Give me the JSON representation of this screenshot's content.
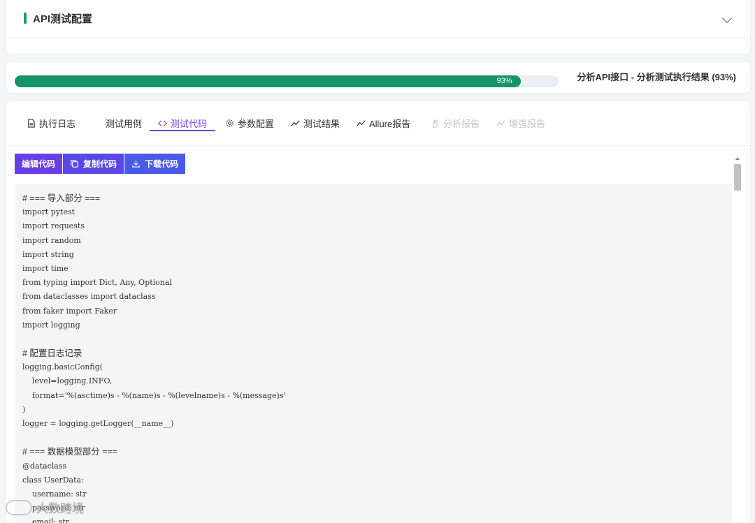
{
  "config": {
    "title": "API测试配置",
    "accent_color": "#1e9e6a",
    "collapse_icon": "chevron-down-icon"
  },
  "progress": {
    "percent_label": "93%",
    "value": 0.93,
    "status_text": "分析API接口 - 分析测试执行结果 (93%)",
    "bar_color": "#16936a"
  },
  "tabs": [
    {
      "label": "执行日志",
      "icon": "document-icon",
      "state": "normal"
    },
    {
      "label": "测试用例",
      "icon": "",
      "state": "normal"
    },
    {
      "label": "测试代码",
      "icon": "code-icon",
      "state": "active"
    },
    {
      "label": "参数配置",
      "icon": "gear-icon",
      "state": "normal"
    },
    {
      "label": "测试结果",
      "icon": "trend-icon",
      "state": "normal"
    },
    {
      "label": "Allure报告",
      "icon": "trend-icon",
      "state": "normal"
    },
    {
      "label": "分析报告",
      "icon": "hand-icon",
      "state": "disabled"
    },
    {
      "label": "增强报告",
      "icon": "trend-icon",
      "state": "disabled"
    }
  ],
  "active_color": "#7b3fe4",
  "toolbar": {
    "edit_label": "编辑代码",
    "copy_label": "复制代码",
    "download_label": "下载代码"
  },
  "code_lines": [
    "# === 导入部分 ===",
    "import pytest",
    "import requests",
    "import random",
    "import string",
    "import time",
    "from typing import Dict, Any, Optional",
    "from dataclasses import dataclass",
    "from faker import Faker",
    "import logging",
    "",
    "# 配置日志记录",
    "logging.basicConfig(",
    "    level=logging.INFO,",
    "    format='%(asctime)s - %(name)s - %(levelname)s - %(message)s'",
    ")",
    "logger = logging.getLogger(__name__)",
    "",
    "# === 数据模型部分 ===",
    "@dataclass",
    "class UserData:",
    "    username: str",
    "    password: str",
    "    email: str"
  ],
  "watermark": {
    "text": "大数跨境"
  }
}
